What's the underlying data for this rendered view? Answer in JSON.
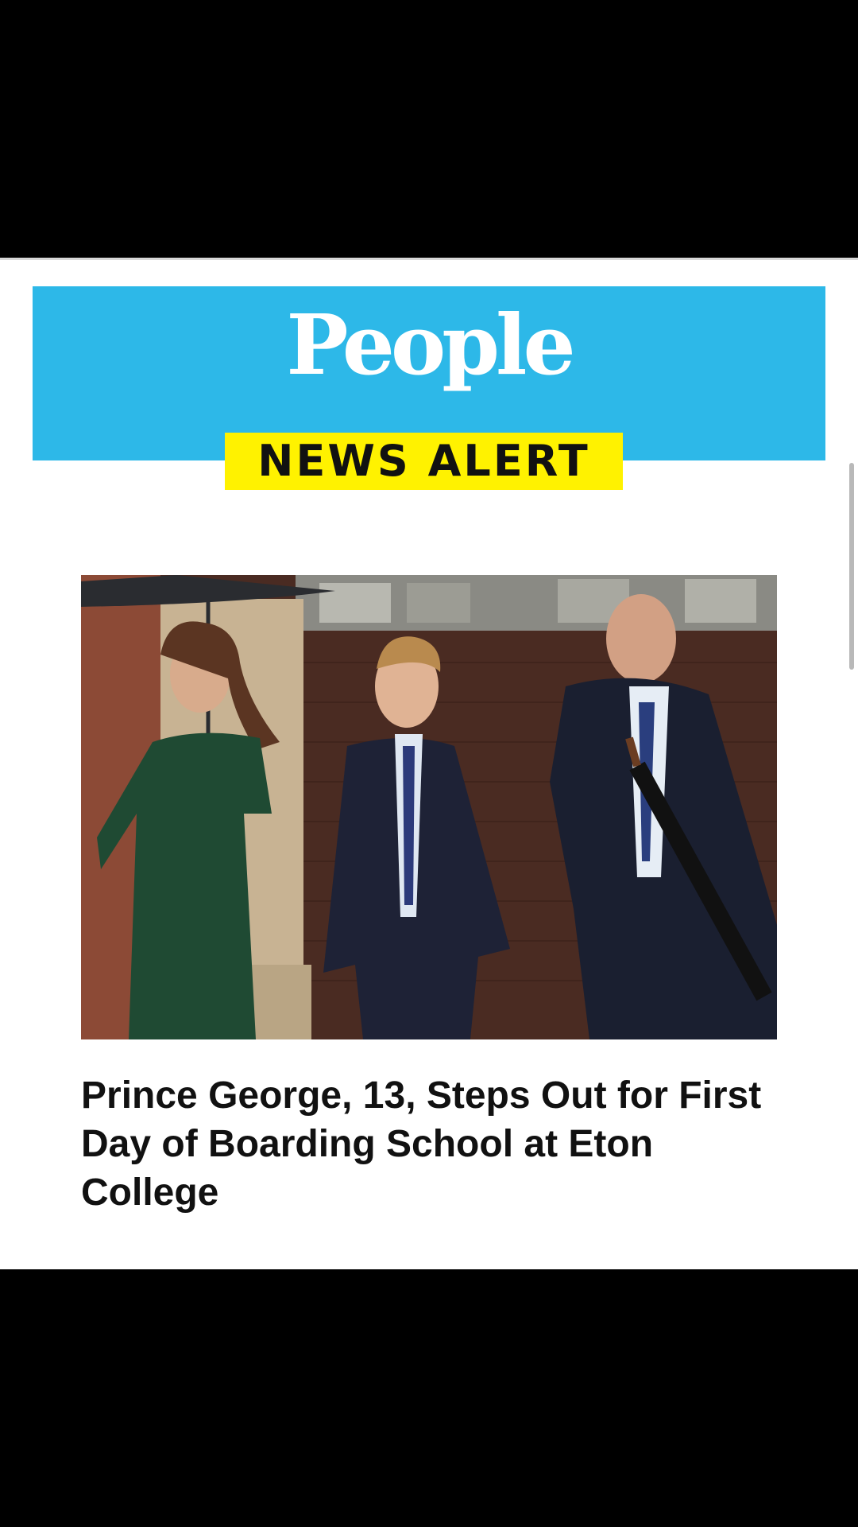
{
  "banner": {
    "logo_text": "People",
    "alert_label": "NEWS ALERT",
    "background_color": "#2db8e8",
    "badge_color": "#fff200"
  },
  "article": {
    "headline": "Prince George, 13, Steps Out for First Day of Boarding School at Eton College",
    "photo_subject": "royal-family-photo"
  },
  "colors": {
    "page_background": "#ffffff",
    "letterbox": "#000000",
    "headline_text": "#111111"
  }
}
